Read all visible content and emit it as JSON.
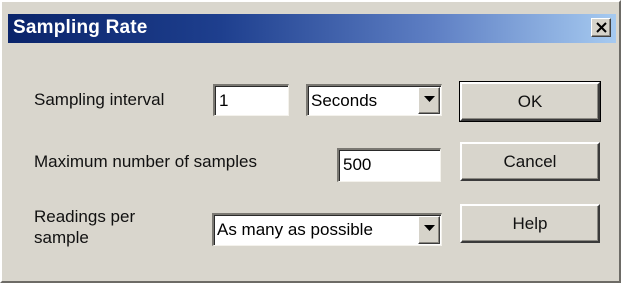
{
  "window": {
    "title": "Sampling Rate",
    "close_glyph": "×"
  },
  "sampling_interval": {
    "label": "Sampling interval",
    "value": "1",
    "unit": {
      "selected": "Seconds"
    }
  },
  "max_samples": {
    "label": "Maximum number of samples",
    "value": "500"
  },
  "readings": {
    "label_line1": "Readings per",
    "label_line2": "sample",
    "selected": "As many as possible"
  },
  "buttons": {
    "ok": "OK",
    "cancel": "Cancel",
    "help": "Help"
  },
  "icons": {
    "close": "close-icon",
    "dropdown": "chevron-down-icon"
  },
  "colors": {
    "titlebar_start": "#0a246a",
    "titlebar_end": "#a6caf0",
    "dialog_bg": "#d9d6cd"
  }
}
